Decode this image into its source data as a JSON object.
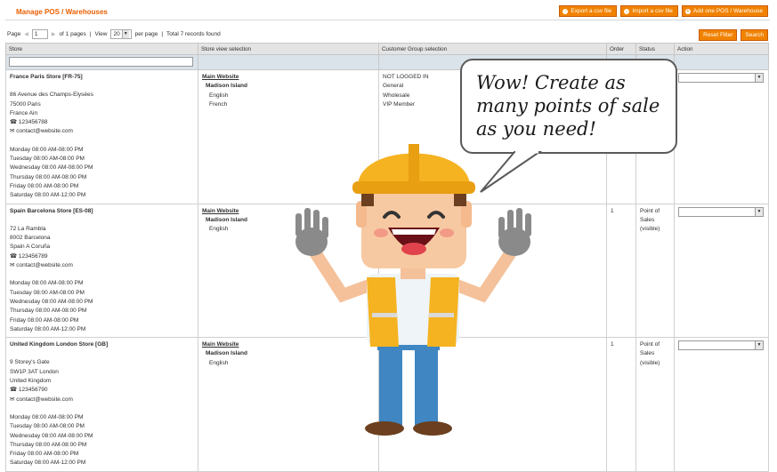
{
  "page": {
    "title": "Manage POS / Warehouses",
    "buttons": {
      "export": "Export a csv file",
      "import": "Import a csv file",
      "add": "Add one POS / Warehouse",
      "reset": "Reset Filter",
      "search": "Search"
    }
  },
  "pager": {
    "page_label": "Page",
    "page_value": "1",
    "of_pages": "of 1 pages",
    "view_label": "View",
    "per_page_value": "20",
    "per_page_label": "per page",
    "records": "Total 7 records found"
  },
  "columns": {
    "store": "Store",
    "store_view": "Store view selection",
    "customer_group": "Customer Group selection",
    "order": "Order",
    "status": "Status",
    "action": "Action"
  },
  "rows": [
    {
      "name": "France Paris Store [FR-75]",
      "address": [
        "86 Avenue des Champs-Elysées",
        "75000 Paris",
        "France Ain"
      ],
      "phone": "123456788",
      "email": "contact@website.com",
      "hours": [
        "Monday 08:00 AM-08:00 PM",
        "Tuesday 08:00 AM-08:00 PM",
        "Wednesday 08:00 AM-08:00 PM",
        "Thursday 08:00 AM-08:00 PM",
        "Friday 08:00 AM-08:00 PM",
        "Saturday 08:00 AM-12:00 PM"
      ],
      "website": "Main Website",
      "store": "Madison Island",
      "views": [
        "English",
        "French"
      ],
      "groups": [
        "NOT LOGGED IN",
        "General",
        "Wholesale",
        "VIP Member"
      ],
      "order": "",
      "status": []
    },
    {
      "name": "Spain Barcelona Store [ES-08]",
      "address": [
        "72 La Rambla",
        "8002 Barcelona",
        "Spain A Coruña"
      ],
      "phone": "123456789",
      "email": "contact@website.com",
      "hours": [
        "Monday 08:00 AM-08:00 PM",
        "Tuesday 08:00 AM-08:00 PM",
        "Wednesday 08:00 AM-08:00 PM",
        "Thursday 08:00 AM-08:00 PM",
        "Friday 08:00 AM-08:00 PM",
        "Saturday 08:00 AM-12:00 PM"
      ],
      "website": "Main Website",
      "store": "Madison Island",
      "views": [
        "English"
      ],
      "groups": [],
      "order": "1",
      "status": [
        "Point of",
        "Sales",
        "(visible)"
      ]
    },
    {
      "name": "United Kingdom London Store [GB]",
      "address": [
        "9 Storey's Gate",
        "SW1P 3AT London",
        "United Kingdom"
      ],
      "phone": "123456790",
      "email": "contact@website.com",
      "hours": [
        "Monday 08:00 AM-08:00 PM",
        "Tuesday 08:00 AM-08:00 PM",
        "Wednesday 08:00 AM-08:00 PM",
        "Thursday 08:00 AM-08:00 PM",
        "Friday 08:00 AM-08:00 PM",
        "Saturday 08:00 AM-12:00 PM"
      ],
      "website": "Main Website",
      "store": "Madison Island",
      "views": [
        "English"
      ],
      "groups": [],
      "order": "1",
      "status": [
        "Point of",
        "Sales",
        "(visible)"
      ]
    }
  ],
  "bubble": {
    "text": "Wow! Create as\nmany points of sale\nas you need!"
  },
  "icons": {
    "phone": "phone-icon",
    "email": "envelope-icon",
    "dropdown": "chevron-down-icon"
  },
  "colors": {
    "accent": "#f18200",
    "title": "#eb5e00",
    "header_bg": "#e4e4e4",
    "filter_bg": "#dbe3ea"
  }
}
